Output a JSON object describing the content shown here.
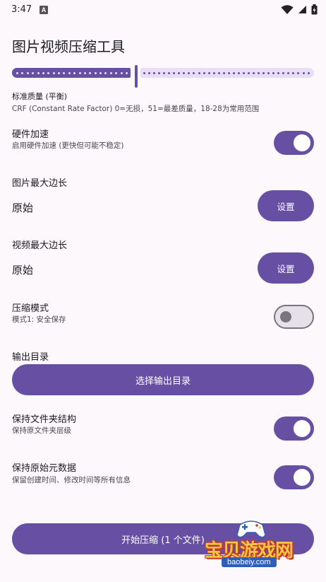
{
  "status_bar": {
    "time": "3:47",
    "notification_letter": "A",
    "icons": [
      "wifi-icon",
      "cell-signal-icon",
      "battery-icon"
    ]
  },
  "app": {
    "title": "图片视频压缩工具"
  },
  "quality": {
    "slider_fraction": 0.41,
    "label": "标准质量 (平衡)",
    "description": "CRF (Constant Rate Factor) 0=无损，51=最差质量，18-28为常用范围"
  },
  "hardware_accel": {
    "title": "硬件加速",
    "subtitle": "启用硬件加速 (更快但可能不稳定)",
    "enabled": true
  },
  "image_max_edge": {
    "title": "图片最大边长",
    "value": "原始",
    "button_label": "设置"
  },
  "video_max_edge": {
    "title": "视频最大边长",
    "value": "原始",
    "button_label": "设置"
  },
  "compress_mode": {
    "title": "压缩模式",
    "subtitle": "模式1: 安全保存",
    "enabled": false
  },
  "output_dir": {
    "title": "输出目录",
    "button_label": "选择输出目录"
  },
  "keep_folder": {
    "title": "保持文件夹结构",
    "subtitle": "保持原文件夹层级",
    "enabled": true
  },
  "keep_metadata": {
    "title": "保持原始元数据",
    "subtitle": "保留创建时间、修改时间等所有信息",
    "enabled": true
  },
  "start": {
    "button_label": "开始压缩 (1 个文件)"
  },
  "watermark": {
    "text": "宝贝游戏网",
    "url": "baobeiy.com"
  },
  "colors": {
    "primary": "#6750a4",
    "primary_container": "#e8def8",
    "background": "#fcf8fc",
    "outline": "#79747e"
  }
}
